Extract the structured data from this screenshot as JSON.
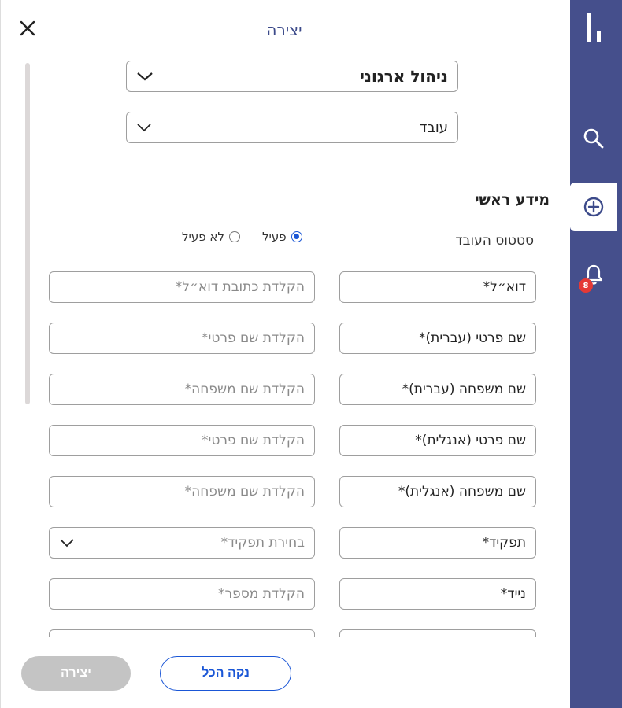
{
  "header": {
    "title": "יצירה"
  },
  "selects": {
    "module": "ניהול ארגוני",
    "entity": "עובד"
  },
  "section": {
    "title": "מידע ראשי",
    "status_label": "סטטוס העובד",
    "status_options": [
      "פעיל",
      "לא פעיל"
    ],
    "status_selected": "פעיל"
  },
  "fields": [
    {
      "label": "דוא״ל*",
      "placeholder": "הקלדת כתובת דוא״ל*"
    },
    {
      "label": "שם פרטי (עברית)*",
      "placeholder": "הקלדת שם פרטי*"
    },
    {
      "label": "שם משפחה (עברית)*",
      "placeholder": "הקלדת שם משפחה*"
    },
    {
      "label": "שם פרטי (אנגלית)*",
      "placeholder": "הקלדת שם פרטי*"
    },
    {
      "label": "שם משפחה (אנגלית)*",
      "placeholder": "הקלדת שם משפחה*"
    },
    {
      "label": "תפקיד*",
      "placeholder": "בחירת תפקיד*"
    },
    {
      "label": "נייד*",
      "placeholder": "הקלדת מספר*"
    }
  ],
  "footer": {
    "create_label": "יצירה",
    "clear_label": "נקה הכל"
  },
  "nav": {
    "notification_count": "8"
  },
  "colors": {
    "nav_bg": "#454f8c",
    "accent": "#1a56d6",
    "badge": "#e53935"
  }
}
